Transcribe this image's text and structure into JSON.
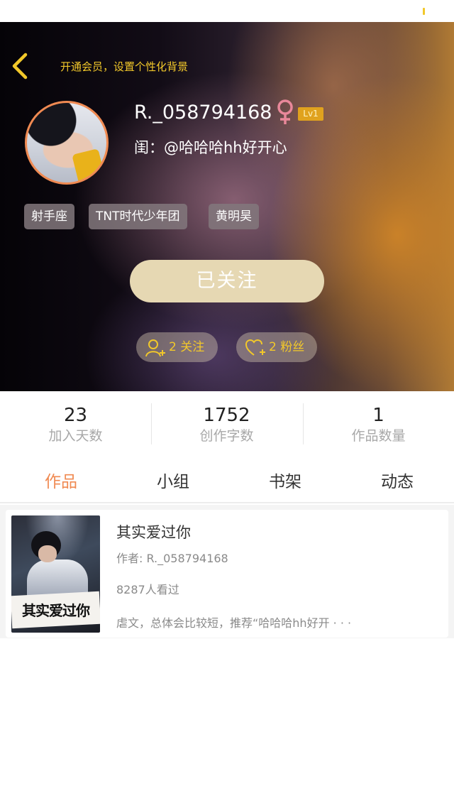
{
  "header": {
    "vip_link": "开通会员，设置个性化背景"
  },
  "profile": {
    "username": "R._058794168",
    "level": "Lv1",
    "bestie": "闺：@哈哈哈hh好开心",
    "tags": [
      "射手座",
      "TNT时代少年团",
      "黄明昊"
    ],
    "follow_button": "已关注",
    "following_label": "2 关注",
    "followers_label": "2 粉丝"
  },
  "stats": [
    {
      "value": "23",
      "label": "加入天数"
    },
    {
      "value": "1752",
      "label": "创作字数"
    },
    {
      "value": "1",
      "label": "作品数量"
    }
  ],
  "tabs": [
    {
      "label": "作品",
      "active": true
    },
    {
      "label": "小组",
      "active": false
    },
    {
      "label": "书架",
      "active": false
    },
    {
      "label": "动态",
      "active": false
    }
  ],
  "works": [
    {
      "cover_text": "其实爱过你",
      "title": "其实爱过你",
      "author": "作者: R._058794168",
      "views": "8287人看过",
      "description": "虐文，总体会比较短，推荐“哈哈哈hh好开 · · ·"
    }
  ],
  "colors": {
    "accent": "#f08a52",
    "gold": "#f2c82a",
    "follow_button": "#e6d8b3"
  }
}
